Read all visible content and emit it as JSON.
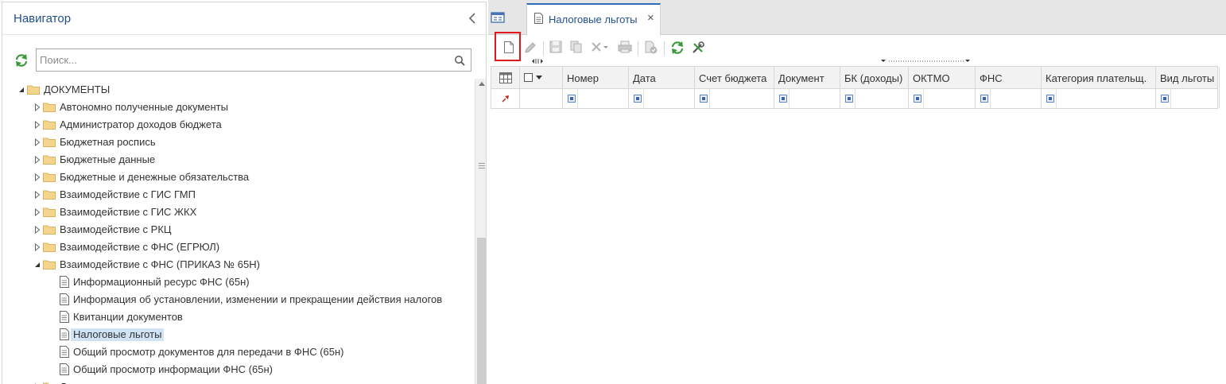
{
  "navigator": {
    "title": "Навигатор",
    "search_placeholder": "Поиск...",
    "tree": [
      {
        "label": "ДОКУМЕНТЫ",
        "level": 0,
        "expanded": true,
        "kind": "folder"
      },
      {
        "label": "Автономно полученные документы",
        "level": 1,
        "expanded": false,
        "kind": "folder"
      },
      {
        "label": "Администратор доходов бюджета",
        "level": 1,
        "expanded": false,
        "kind": "folder"
      },
      {
        "label": "Бюджетная роспись",
        "level": 1,
        "expanded": false,
        "kind": "folder"
      },
      {
        "label": "Бюджетные данные",
        "level": 1,
        "expanded": false,
        "kind": "folder"
      },
      {
        "label": "Бюджетные и денежные обязательства",
        "level": 1,
        "expanded": false,
        "kind": "folder"
      },
      {
        "label": "Взаимодействие с ГИС ГМП",
        "level": 1,
        "expanded": false,
        "kind": "folder"
      },
      {
        "label": "Взаимодействие с ГИС ЖКХ",
        "level": 1,
        "expanded": false,
        "kind": "folder"
      },
      {
        "label": "Взаимодействие с РКЦ",
        "level": 1,
        "expanded": false,
        "kind": "folder"
      },
      {
        "label": "Взаимодействие с ФНС (ЕГРЮЛ)",
        "level": 1,
        "expanded": false,
        "kind": "folder"
      },
      {
        "label": "Взаимодействие с ФНС (ПРИКАЗ № 65Н)",
        "level": 1,
        "expanded": true,
        "kind": "folder"
      },
      {
        "label": "Информационный ресурс ФНС (65н)",
        "level": 2,
        "kind": "doc"
      },
      {
        "label": "Информация об установлении, изменении и прекращении действия налогов",
        "level": 2,
        "kind": "doc"
      },
      {
        "label": "Квитанции документов",
        "level": 2,
        "kind": "doc"
      },
      {
        "label": "Налоговые льготы",
        "level": 2,
        "kind": "doc",
        "selected": true
      },
      {
        "label": "Общий просмотр документов для передачи в ФНС (65н)",
        "level": 2,
        "kind": "doc"
      },
      {
        "label": "Общий просмотр информации ФНС (65н)",
        "level": 2,
        "kind": "doc"
      },
      {
        "label": "Доходные документы",
        "level": 1,
        "expanded": false,
        "kind": "folder"
      }
    ]
  },
  "tabs": {
    "active_label": "Налоговые льготы",
    "close_glyph": "×"
  },
  "grid": {
    "columns": [
      "Номер",
      "Дата",
      "Счет бюджета",
      "Документ",
      "БК (доходы)",
      "ОКТМО",
      "ФНС",
      "Категория плательщ.",
      "Вид льготы"
    ]
  },
  "colors": {
    "accent": "#2f6fb6",
    "highlight_box": "#e0191f",
    "refresh_green": "#3a9a3a",
    "selected_row": "#cfe3f5"
  }
}
